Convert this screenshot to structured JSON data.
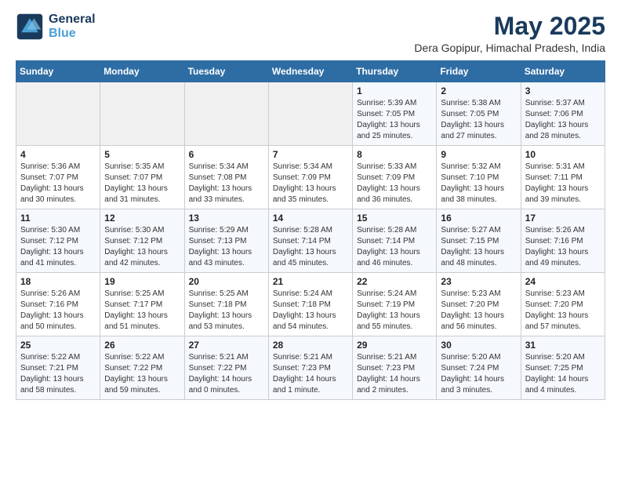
{
  "logo": {
    "line1": "General",
    "line2": "Blue"
  },
  "header": {
    "title": "May 2025",
    "subtitle": "Dera Gopipur, Himachal Pradesh, India"
  },
  "weekdays": [
    "Sunday",
    "Monday",
    "Tuesday",
    "Wednesday",
    "Thursday",
    "Friday",
    "Saturday"
  ],
  "weeks": [
    [
      {
        "day": "",
        "info": ""
      },
      {
        "day": "",
        "info": ""
      },
      {
        "day": "",
        "info": ""
      },
      {
        "day": "",
        "info": ""
      },
      {
        "day": "1",
        "info": "Sunrise: 5:39 AM\nSunset: 7:05 PM\nDaylight: 13 hours\nand 25 minutes."
      },
      {
        "day": "2",
        "info": "Sunrise: 5:38 AM\nSunset: 7:05 PM\nDaylight: 13 hours\nand 27 minutes."
      },
      {
        "day": "3",
        "info": "Sunrise: 5:37 AM\nSunset: 7:06 PM\nDaylight: 13 hours\nand 28 minutes."
      }
    ],
    [
      {
        "day": "4",
        "info": "Sunrise: 5:36 AM\nSunset: 7:07 PM\nDaylight: 13 hours\nand 30 minutes."
      },
      {
        "day": "5",
        "info": "Sunrise: 5:35 AM\nSunset: 7:07 PM\nDaylight: 13 hours\nand 31 minutes."
      },
      {
        "day": "6",
        "info": "Sunrise: 5:34 AM\nSunset: 7:08 PM\nDaylight: 13 hours\nand 33 minutes."
      },
      {
        "day": "7",
        "info": "Sunrise: 5:34 AM\nSunset: 7:09 PM\nDaylight: 13 hours\nand 35 minutes."
      },
      {
        "day": "8",
        "info": "Sunrise: 5:33 AM\nSunset: 7:09 PM\nDaylight: 13 hours\nand 36 minutes."
      },
      {
        "day": "9",
        "info": "Sunrise: 5:32 AM\nSunset: 7:10 PM\nDaylight: 13 hours\nand 38 minutes."
      },
      {
        "day": "10",
        "info": "Sunrise: 5:31 AM\nSunset: 7:11 PM\nDaylight: 13 hours\nand 39 minutes."
      }
    ],
    [
      {
        "day": "11",
        "info": "Sunrise: 5:30 AM\nSunset: 7:12 PM\nDaylight: 13 hours\nand 41 minutes."
      },
      {
        "day": "12",
        "info": "Sunrise: 5:30 AM\nSunset: 7:12 PM\nDaylight: 13 hours\nand 42 minutes."
      },
      {
        "day": "13",
        "info": "Sunrise: 5:29 AM\nSunset: 7:13 PM\nDaylight: 13 hours\nand 43 minutes."
      },
      {
        "day": "14",
        "info": "Sunrise: 5:28 AM\nSunset: 7:14 PM\nDaylight: 13 hours\nand 45 minutes."
      },
      {
        "day": "15",
        "info": "Sunrise: 5:28 AM\nSunset: 7:14 PM\nDaylight: 13 hours\nand 46 minutes."
      },
      {
        "day": "16",
        "info": "Sunrise: 5:27 AM\nSunset: 7:15 PM\nDaylight: 13 hours\nand 48 minutes."
      },
      {
        "day": "17",
        "info": "Sunrise: 5:26 AM\nSunset: 7:16 PM\nDaylight: 13 hours\nand 49 minutes."
      }
    ],
    [
      {
        "day": "18",
        "info": "Sunrise: 5:26 AM\nSunset: 7:16 PM\nDaylight: 13 hours\nand 50 minutes."
      },
      {
        "day": "19",
        "info": "Sunrise: 5:25 AM\nSunset: 7:17 PM\nDaylight: 13 hours\nand 51 minutes."
      },
      {
        "day": "20",
        "info": "Sunrise: 5:25 AM\nSunset: 7:18 PM\nDaylight: 13 hours\nand 53 minutes."
      },
      {
        "day": "21",
        "info": "Sunrise: 5:24 AM\nSunset: 7:18 PM\nDaylight: 13 hours\nand 54 minutes."
      },
      {
        "day": "22",
        "info": "Sunrise: 5:24 AM\nSunset: 7:19 PM\nDaylight: 13 hours\nand 55 minutes."
      },
      {
        "day": "23",
        "info": "Sunrise: 5:23 AM\nSunset: 7:20 PM\nDaylight: 13 hours\nand 56 minutes."
      },
      {
        "day": "24",
        "info": "Sunrise: 5:23 AM\nSunset: 7:20 PM\nDaylight: 13 hours\nand 57 minutes."
      }
    ],
    [
      {
        "day": "25",
        "info": "Sunrise: 5:22 AM\nSunset: 7:21 PM\nDaylight: 13 hours\nand 58 minutes."
      },
      {
        "day": "26",
        "info": "Sunrise: 5:22 AM\nSunset: 7:22 PM\nDaylight: 13 hours\nand 59 minutes."
      },
      {
        "day": "27",
        "info": "Sunrise: 5:21 AM\nSunset: 7:22 PM\nDaylight: 14 hours\nand 0 minutes."
      },
      {
        "day": "28",
        "info": "Sunrise: 5:21 AM\nSunset: 7:23 PM\nDaylight: 14 hours\nand 1 minute."
      },
      {
        "day": "29",
        "info": "Sunrise: 5:21 AM\nSunset: 7:23 PM\nDaylight: 14 hours\nand 2 minutes."
      },
      {
        "day": "30",
        "info": "Sunrise: 5:20 AM\nSunset: 7:24 PM\nDaylight: 14 hours\nand 3 minutes."
      },
      {
        "day": "31",
        "info": "Sunrise: 5:20 AM\nSunset: 7:25 PM\nDaylight: 14 hours\nand 4 minutes."
      }
    ]
  ]
}
